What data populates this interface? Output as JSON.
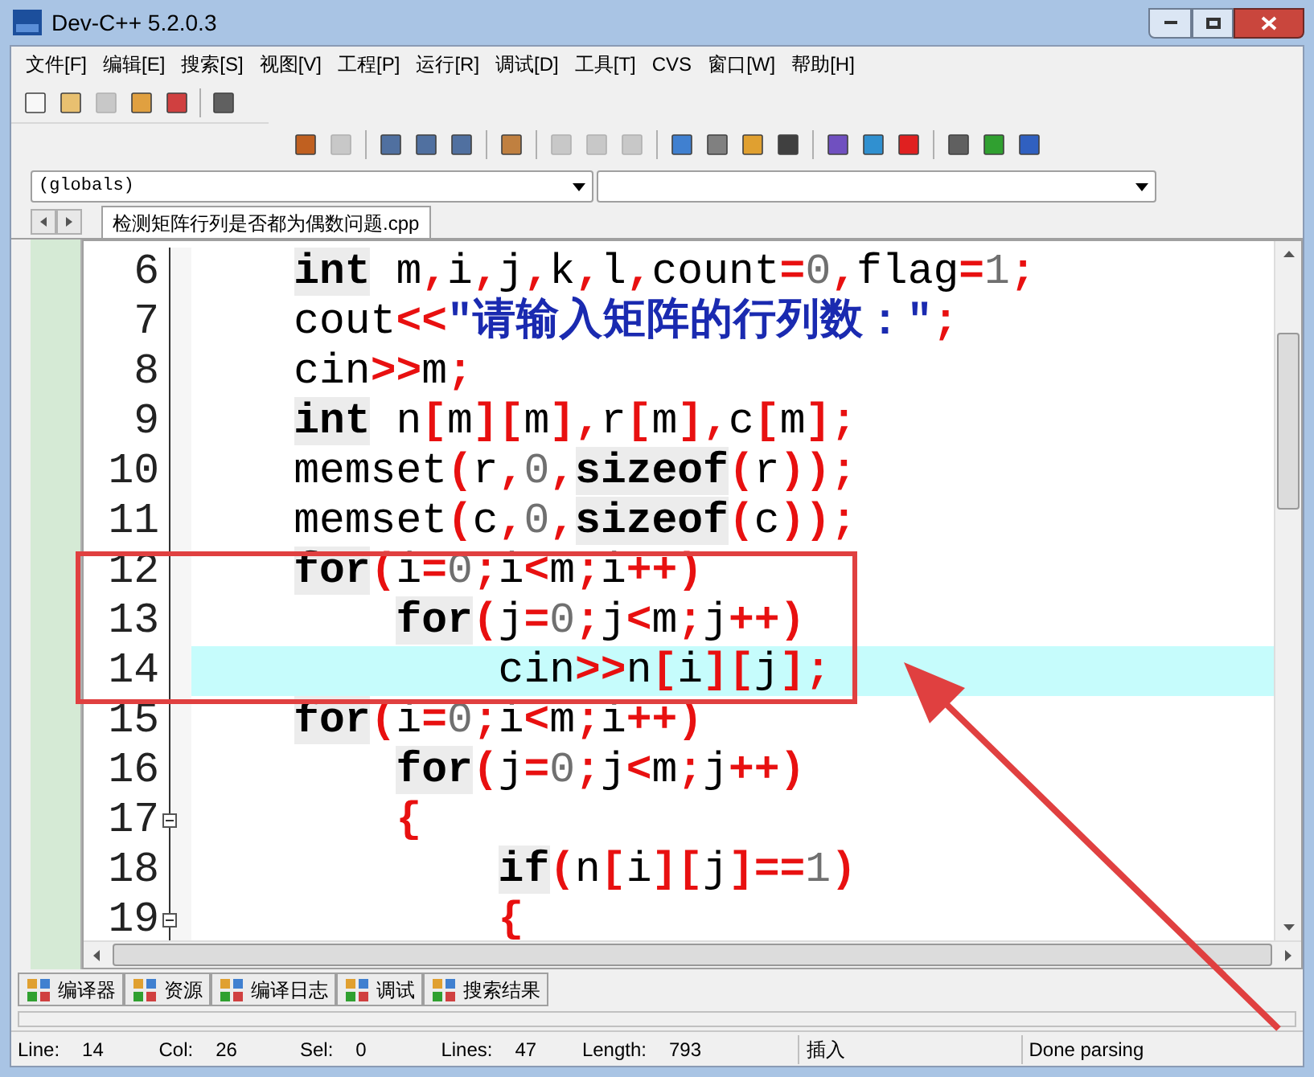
{
  "window": {
    "title": "Dev-C++ 5.2.0.3"
  },
  "menu": [
    "文件[F]",
    "编辑[E]",
    "搜索[S]",
    "视图[V]",
    "工程[P]",
    "运行[R]",
    "调试[D]",
    "工具[T]",
    "CVS",
    "窗口[W]",
    "帮助[H]"
  ],
  "toolbar_1": [
    {
      "disabled": false
    },
    {
      "disabled": false
    },
    {
      "disabled": true
    },
    {
      "disabled": false
    },
    {
      "disabled": false
    },
    {
      "disabled": false
    }
  ],
  "toolbar_2": [
    {
      "disabled": false
    },
    {
      "disabled": true
    },
    {
      "disabled": false
    },
    {
      "disabled": false
    },
    {
      "disabled": false
    },
    {
      "disabled": false
    },
    {
      "disabled": true
    },
    {
      "disabled": true
    },
    {
      "disabled": true
    },
    {
      "disabled": false
    },
    {
      "disabled": false
    },
    {
      "disabled": false
    },
    {
      "disabled": false
    },
    {
      "disabled": false
    },
    {
      "disabled": false
    },
    {
      "disabled": false
    },
    {
      "disabled": false
    },
    {
      "disabled": false
    },
    {
      "disabled": false
    }
  ],
  "class_selector": {
    "value": "(globals)"
  },
  "file_tabs": [
    {
      "label": "检测矩阵行列是否都为偶数问题.cpp",
      "selected": true
    }
  ],
  "editor": {
    "lines": [
      {
        "number": "6",
        "current": false,
        "fold": false,
        "tokens": [
          {
            "kind": "keyword",
            "text": "int"
          },
          {
            "kind": "plain",
            "text": " m"
          },
          {
            "kind": "op",
            "text": ","
          },
          {
            "kind": "plain",
            "text": "i"
          },
          {
            "kind": "op",
            "text": ","
          },
          {
            "kind": "plain",
            "text": "j"
          },
          {
            "kind": "op",
            "text": ","
          },
          {
            "kind": "plain",
            "text": "k"
          },
          {
            "kind": "op",
            "text": ","
          },
          {
            "kind": "plain",
            "text": "l"
          },
          {
            "kind": "op",
            "text": ","
          },
          {
            "kind": "plain",
            "text": "count"
          },
          {
            "kind": "op",
            "text": "="
          },
          {
            "kind": "number",
            "text": "0"
          },
          {
            "kind": "op",
            "text": ","
          },
          {
            "kind": "plain",
            "text": "flag"
          },
          {
            "kind": "op",
            "text": "="
          },
          {
            "kind": "number",
            "text": "1"
          },
          {
            "kind": "op",
            "text": ";"
          }
        ]
      },
      {
        "number": "7",
        "current": false,
        "fold": false,
        "tokens": [
          {
            "kind": "plain",
            "text": "cout"
          },
          {
            "kind": "op",
            "text": "<<"
          },
          {
            "kind": "string",
            "text": "\"请输入矩阵的行列数：\""
          },
          {
            "kind": "op",
            "text": ";"
          }
        ]
      },
      {
        "number": "8",
        "current": false,
        "fold": false,
        "tokens": [
          {
            "kind": "plain",
            "text": "cin"
          },
          {
            "kind": "op",
            "text": ">>"
          },
          {
            "kind": "plain",
            "text": "m"
          },
          {
            "kind": "op",
            "text": ";"
          }
        ]
      },
      {
        "number": "9",
        "current": false,
        "fold": false,
        "tokens": [
          {
            "kind": "keyword",
            "text": "int"
          },
          {
            "kind": "plain",
            "text": " n"
          },
          {
            "kind": "op",
            "text": "["
          },
          {
            "kind": "plain",
            "text": "m"
          },
          {
            "kind": "op",
            "text": "]["
          },
          {
            "kind": "plain",
            "text": "m"
          },
          {
            "kind": "op",
            "text": "],"
          },
          {
            "kind": "plain",
            "text": "r"
          },
          {
            "kind": "op",
            "text": "["
          },
          {
            "kind": "plain",
            "text": "m"
          },
          {
            "kind": "op",
            "text": "],"
          },
          {
            "kind": "plain",
            "text": "c"
          },
          {
            "kind": "op",
            "text": "["
          },
          {
            "kind": "plain",
            "text": "m"
          },
          {
            "kind": "op",
            "text": "];"
          }
        ]
      },
      {
        "number": "10",
        "current": false,
        "fold": false,
        "tokens": [
          {
            "kind": "plain",
            "text": "memset"
          },
          {
            "kind": "op",
            "text": "("
          },
          {
            "kind": "plain",
            "text": "r"
          },
          {
            "kind": "op",
            "text": ","
          },
          {
            "kind": "number",
            "text": "0"
          },
          {
            "kind": "op",
            "text": ","
          },
          {
            "kind": "keyword",
            "text": "sizeof"
          },
          {
            "kind": "op",
            "text": "("
          },
          {
            "kind": "plain",
            "text": "r"
          },
          {
            "kind": "op",
            "text": "));"
          }
        ]
      },
      {
        "number": "11",
        "current": false,
        "fold": false,
        "tokens": [
          {
            "kind": "plain",
            "text": "memset"
          },
          {
            "kind": "op",
            "text": "("
          },
          {
            "kind": "plain",
            "text": "c"
          },
          {
            "kind": "op",
            "text": ","
          },
          {
            "kind": "number",
            "text": "0"
          },
          {
            "kind": "op",
            "text": ","
          },
          {
            "kind": "keyword",
            "text": "sizeof"
          },
          {
            "kind": "op",
            "text": "("
          },
          {
            "kind": "plain",
            "text": "c"
          },
          {
            "kind": "op",
            "text": "));"
          }
        ]
      },
      {
        "number": "12",
        "current": false,
        "fold": false,
        "tokens": [
          {
            "kind": "keyword",
            "text": "for"
          },
          {
            "kind": "op",
            "text": "("
          },
          {
            "kind": "plain",
            "text": "i"
          },
          {
            "kind": "op",
            "text": "="
          },
          {
            "kind": "number",
            "text": "0"
          },
          {
            "kind": "op",
            "text": ";"
          },
          {
            "kind": "plain",
            "text": "i"
          },
          {
            "kind": "op",
            "text": "<"
          },
          {
            "kind": "plain",
            "text": "m"
          },
          {
            "kind": "op",
            "text": ";"
          },
          {
            "kind": "plain",
            "text": "i"
          },
          {
            "kind": "op",
            "text": "++)"
          }
        ],
        "children": [
          {
            "number": "13",
            "current": false,
            "fold": false,
            "tokens": [
              {
                "kind": "keyword",
                "text": "for"
              },
              {
                "kind": "op",
                "text": "("
              },
              {
                "kind": "plain",
                "text": "j"
              },
              {
                "kind": "op",
                "text": "="
              },
              {
                "kind": "number",
                "text": "0"
              },
              {
                "kind": "op",
                "text": ";"
              },
              {
                "kind": "plain",
                "text": "j"
              },
              {
                "kind": "op",
                "text": "<"
              },
              {
                "kind": "plain",
                "text": "m"
              },
              {
                "kind": "op",
                "text": ";"
              },
              {
                "kind": "plain",
                "text": "j"
              },
              {
                "kind": "op",
                "text": "++)"
              }
            ],
            "children": [
              {
                "number": "14",
                "current": true,
                "fold": false,
                "tokens": [
                  {
                    "kind": "plain",
                    "text": "cin"
                  },
                  {
                    "kind": "op",
                    "text": ">>"
                  },
                  {
                    "kind": "plain",
                    "text": "n"
                  },
                  {
                    "kind": "op",
                    "text": "["
                  },
                  {
                    "kind": "plain",
                    "text": "i"
                  },
                  {
                    "kind": "op",
                    "text": "]["
                  },
                  {
                    "kind": "plain",
                    "text": "j"
                  },
                  {
                    "kind": "op",
                    "text": "];"
                  }
                ]
              }
            ]
          }
        ]
      },
      {
        "number": "15",
        "current": false,
        "fold": false,
        "tokens": [
          {
            "kind": "keyword",
            "text": "for"
          },
          {
            "kind": "op",
            "text": "("
          },
          {
            "kind": "plain",
            "text": "i"
          },
          {
            "kind": "op",
            "text": "="
          },
          {
            "kind": "number",
            "text": "0"
          },
          {
            "kind": "op",
            "text": ";"
          },
          {
            "kind": "plain",
            "text": "i"
          },
          {
            "kind": "op",
            "text": "<"
          },
          {
            "kind": "plain",
            "text": "m"
          },
          {
            "kind": "op",
            "text": ";"
          },
          {
            "kind": "plain",
            "text": "i"
          },
          {
            "kind": "op",
            "text": "++)"
          }
        ],
        "children": [
          {
            "number": "16",
            "current": false,
            "fold": false,
            "tokens": [
              {
                "kind": "keyword",
                "text": "for"
              },
              {
                "kind": "op",
                "text": "("
              },
              {
                "kind": "plain",
                "text": "j"
              },
              {
                "kind": "op",
                "text": "="
              },
              {
                "kind": "number",
                "text": "0"
              },
              {
                "kind": "op",
                "text": ";"
              },
              {
                "kind": "plain",
                "text": "j"
              },
              {
                "kind": "op",
                "text": "<"
              },
              {
                "kind": "plain",
                "text": "m"
              },
              {
                "kind": "op",
                "text": ";"
              },
              {
                "kind": "plain",
                "text": "j"
              },
              {
                "kind": "op",
                "text": "++)"
              }
            ]
          },
          {
            "number": "17",
            "current": false,
            "fold": true,
            "tokens": [
              {
                "kind": "op",
                "text": "{"
              }
            ],
            "children": [
              {
                "number": "18",
                "current": false,
                "fold": false,
                "tokens": [
                  {
                    "kind": "keyword",
                    "text": "if"
                  },
                  {
                    "kind": "op",
                    "text": "("
                  },
                  {
                    "kind": "plain",
                    "text": "n"
                  },
                  {
                    "kind": "op",
                    "text": "["
                  },
                  {
                    "kind": "plain",
                    "text": "i"
                  },
                  {
                    "kind": "op",
                    "text": "]["
                  },
                  {
                    "kind": "plain",
                    "text": "j"
                  },
                  {
                    "kind": "op",
                    "text": "]=="
                  },
                  {
                    "kind": "number",
                    "text": "1"
                  },
                  {
                    "kind": "op",
                    "text": ")"
                  }
                ]
              },
              {
                "number": "19",
                "current": false,
                "fold": true,
                "tokens": [
                  {
                    "kind": "op",
                    "text": "{"
                  }
                ]
              }
            ]
          }
        ]
      }
    ]
  },
  "bottom_tabs": [
    {
      "label": "编译器",
      "selected": false
    },
    {
      "label": "资源",
      "selected": false
    },
    {
      "label": "编译日志",
      "selected": false
    },
    {
      "label": "调试",
      "selected": false
    },
    {
      "label": "搜索结果",
      "selected": false
    }
  ],
  "status_bar": [
    {
      "label": "Line:",
      "value": "14"
    },
    {
      "label": "Col:",
      "value": "26"
    },
    {
      "label": "Sel:",
      "value": "0"
    },
    {
      "label": "Lines:",
      "value": "47"
    },
    {
      "label": "Length:",
      "value": "793"
    },
    {
      "value": "插入"
    },
    {
      "value": "Done parsing"
    }
  ]
}
